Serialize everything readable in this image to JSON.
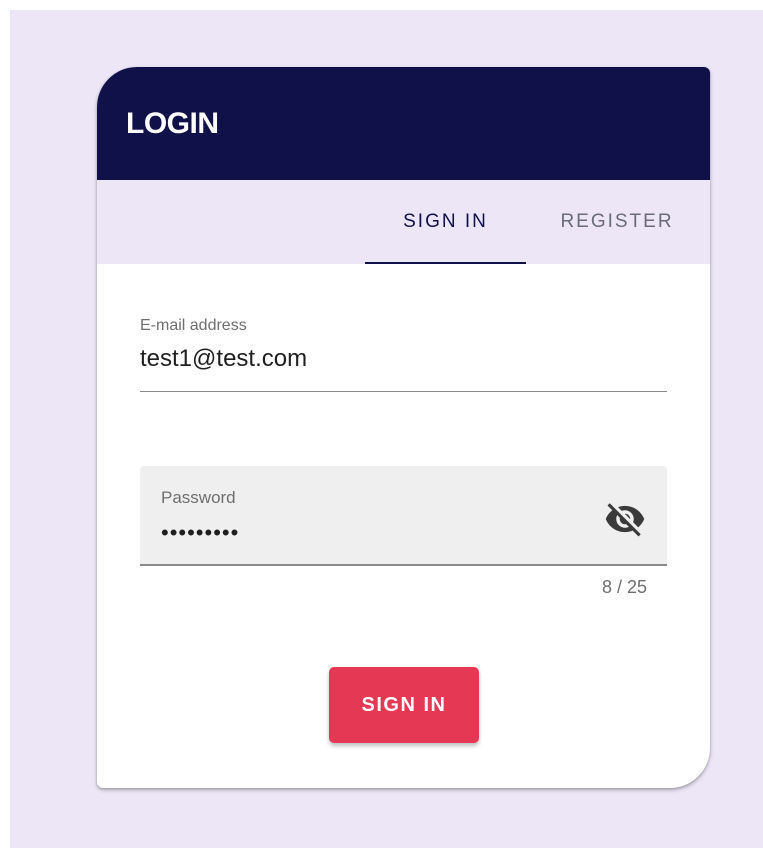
{
  "card": {
    "title": "LOGIN"
  },
  "tabs": {
    "items": [
      {
        "label": "SIGN IN",
        "active": true
      },
      {
        "label": "REGISTER",
        "active": false
      }
    ]
  },
  "form": {
    "email": {
      "label": "E-mail address",
      "value": "test1@test.com"
    },
    "password": {
      "label": "Password",
      "value": "•••••••••",
      "counter": "8 / 25",
      "toggle_icon": "visibility-off-icon"
    },
    "submit_label": "SIGN IN"
  },
  "colors": {
    "header_bg": "#11114a",
    "page_bg": "#ece6f6",
    "accent": "#e53855"
  }
}
